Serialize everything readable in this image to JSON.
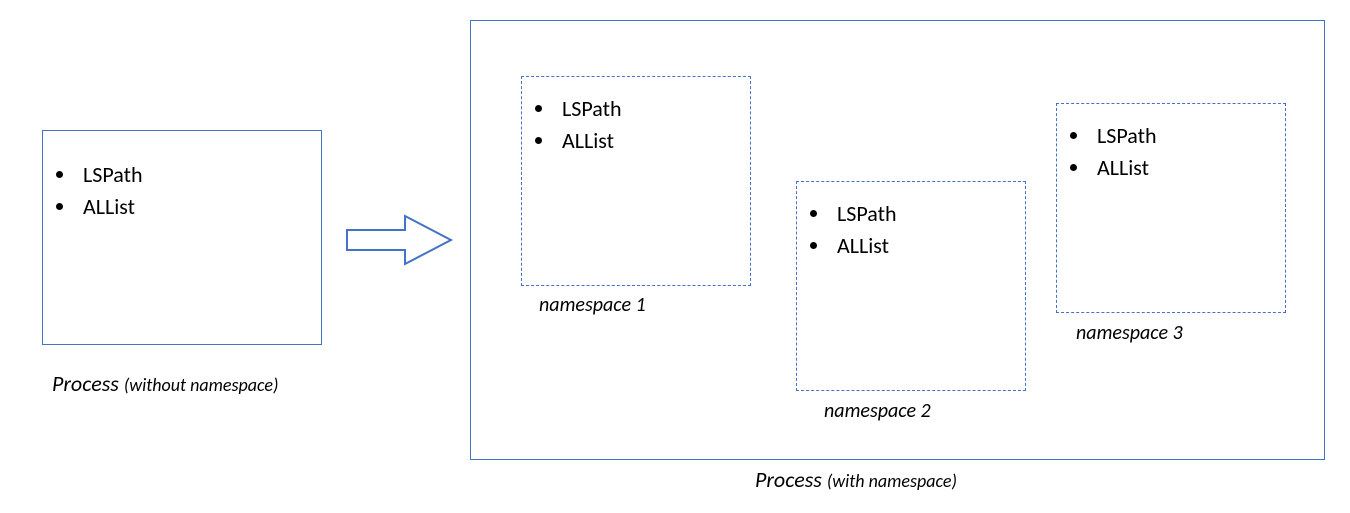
{
  "left_box": {
    "items": [
      "LSPath",
      "ALList"
    ],
    "caption_main": "Process ",
    "caption_sub": "(without namespace)"
  },
  "right_box": {
    "caption_main": "Process ",
    "caption_sub": "(with namespace)",
    "namespaces": [
      {
        "label": "namespace 1",
        "items": [
          "LSPath",
          "ALList"
        ]
      },
      {
        "label": "namespace 2",
        "items": [
          "LSPath",
          "ALList"
        ]
      },
      {
        "label": "namespace 3",
        "items": [
          "LSPath",
          "ALList"
        ]
      }
    ]
  }
}
